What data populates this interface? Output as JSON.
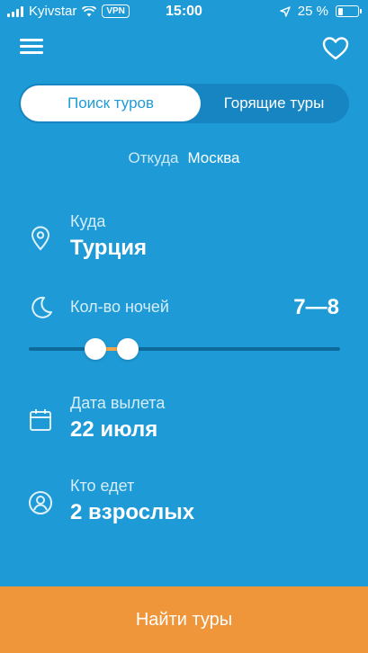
{
  "status": {
    "carrier": "Kyivstar",
    "vpn": "VPN",
    "time": "15:00",
    "battery": "25 %"
  },
  "tabs": {
    "active": "Поиск туров",
    "inactive": "Горящие туры"
  },
  "origin": {
    "label": "Откуда",
    "value": "Москва"
  },
  "destination": {
    "label": "Куда",
    "value": "Турция"
  },
  "nights": {
    "label": "Кол-во ночей",
    "value": "7—8",
    "range_min": 7,
    "range_max": 8
  },
  "departure": {
    "label": "Дата вылета",
    "value": "22 июля"
  },
  "travelers": {
    "label": "Кто едет",
    "value": "2 взрослых"
  },
  "action": {
    "label": "Найти туры"
  },
  "colors": {
    "background": "#1E9BD7",
    "accent": "#F0963A",
    "slider_fill": "#F0A64A"
  },
  "icons": [
    "menu-icon",
    "heart-icon",
    "location-pin-icon",
    "moon-icon",
    "calendar-icon",
    "person-icon"
  ]
}
